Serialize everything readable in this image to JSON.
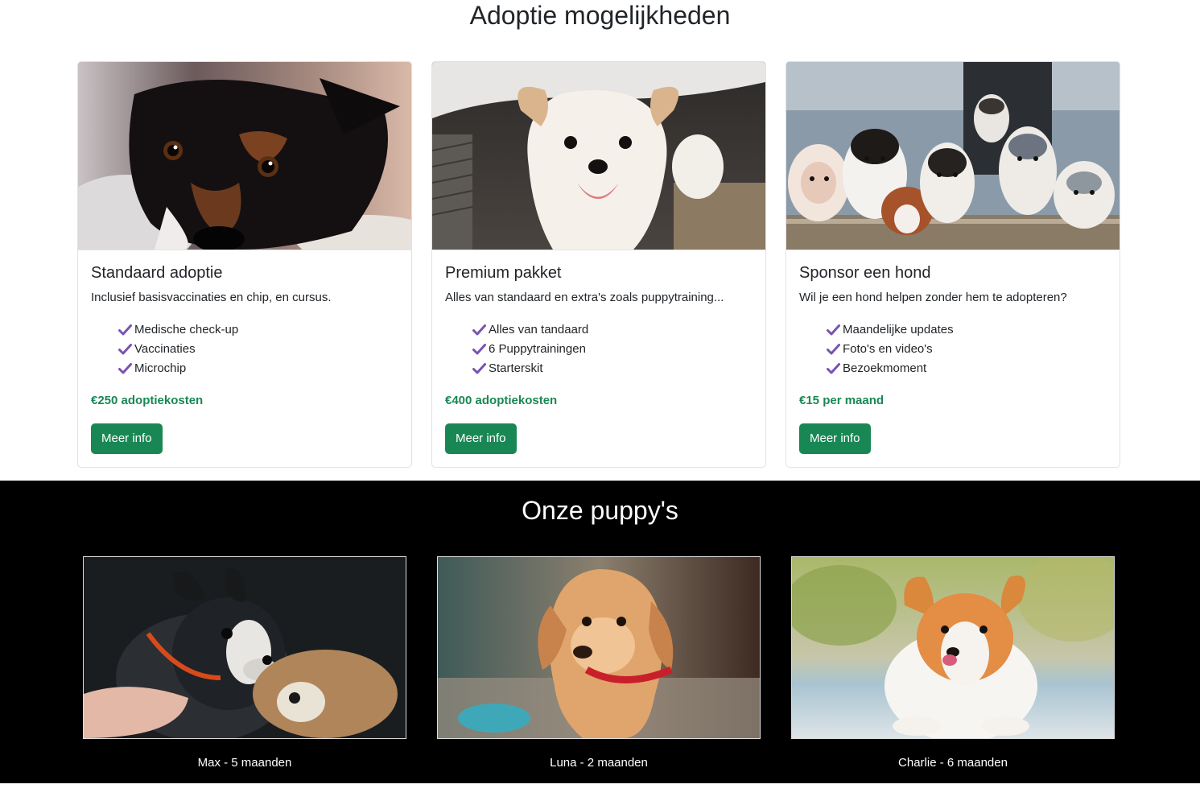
{
  "adoption": {
    "title": "Adoptie mogelijkheden",
    "cards": [
      {
        "image": "black-dog-closeup-photo",
        "title": "Standaard adoptie",
        "text": "Inclusief basisvaccinaties en chip, en cursus.",
        "features": [
          "Medische check-up",
          "Vaccinaties",
          "Microchip"
        ],
        "price": "€250 adoptiekosten",
        "button": "Meer info"
      },
      {
        "image": "white-fluffy-dog-photo",
        "title": "Premium pakket",
        "text": "Alles van standaard en extra's zoals puppytraining...",
        "features": [
          "Alles van tandaard",
          "6 Puppytrainingen",
          "Starterskit"
        ],
        "price": "€400 adoptiekosten",
        "button": "Meer info"
      },
      {
        "image": "puppy-litter-photo",
        "title": "Sponsor een hond",
        "text": "Wil je een hond helpen zonder hem te adopteren?",
        "features": [
          "Maandelijke updates",
          "Foto's en video's",
          "Bezoekmoment"
        ],
        "price": "€15 per maand",
        "button": "Meer info"
      }
    ]
  },
  "puppies": {
    "title": "Onze puppy's",
    "items": [
      {
        "image": "boston-terrier-puppy-photo",
        "caption": "Max - 5 maanden"
      },
      {
        "image": "golden-retriever-puppy-photo",
        "caption": "Luna - 2 maanden"
      },
      {
        "image": "corgi-dog-photo",
        "caption": "Charlie - 6 maanden"
      }
    ]
  },
  "colors": {
    "accent_green": "#198754",
    "check_purple": "#7952b3",
    "dark_section": "#000000"
  }
}
